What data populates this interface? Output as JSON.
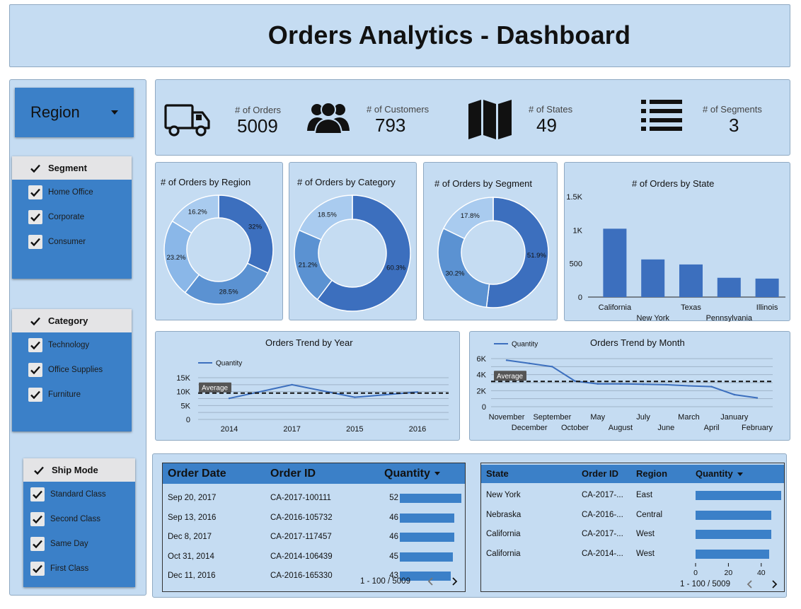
{
  "title": "Orders Analytics - Dashboard",
  "region_dropdown": {
    "label": "Region"
  },
  "filters": {
    "segment": {
      "title": "Segment",
      "items": [
        "Home Office",
        "Corporate",
        "Consumer"
      ]
    },
    "category": {
      "title": "Category",
      "items": [
        "Technology",
        "Office Supplies",
        "Furniture"
      ]
    },
    "ship_mode": {
      "title": "Ship Mode",
      "items": [
        "Standard Class",
        "Second Class",
        "Same Day",
        "First Class"
      ]
    }
  },
  "kpis": {
    "orders": {
      "caption": "# of Orders",
      "value": "5009",
      "icon": "truck-icon"
    },
    "customers": {
      "caption": "# of Customers",
      "value": "793",
      "icon": "users-icon"
    },
    "states": {
      "caption": "# of States",
      "value": "49",
      "icon": "map-icon"
    },
    "segments": {
      "caption": "# of Segments",
      "value": "3",
      "icon": "list-icon"
    }
  },
  "colors": {
    "dark": "#3c6fbe",
    "mid": "#5b92d2",
    "light": "#8ab7e8",
    "lighter": "#a9cbef",
    "panel": "#c5dcf2",
    "accent": "#3b80c8"
  },
  "chart_data": [
    {
      "type": "pie",
      "title": "# of Orders by Region",
      "labels": [
        "32%",
        "28.5%",
        "23.2%",
        "16.2%"
      ],
      "values": [
        32,
        28.5,
        23.2,
        16.2
      ]
    },
    {
      "type": "pie",
      "title": "# of Orders by Category",
      "labels": [
        "60.3%",
        "21.2%",
        "18.5%"
      ],
      "values": [
        60.3,
        21.2,
        18.5
      ]
    },
    {
      "type": "pie",
      "title": "# of Orders by Segment",
      "labels": [
        "51.9%",
        "30.2%",
        "17.8%"
      ],
      "values": [
        51.9,
        30.2,
        17.8
      ]
    },
    {
      "type": "bar",
      "title": "# of Orders by State",
      "categories": [
        "California",
        "New York",
        "Texas",
        "Pennsylvania",
        "Illinois"
      ],
      "values": [
        1021,
        562,
        487,
        288,
        276
      ],
      "ylim": [
        0,
        1500
      ],
      "yticks": [
        "0",
        "500",
        "1K",
        "1.5K"
      ]
    },
    {
      "type": "line",
      "title": "Orders Trend by Year",
      "legend": "Quantity",
      "average_label": "Average",
      "categories": [
        "2014",
        "2017",
        "2015",
        "2016"
      ],
      "values": [
        7581,
        12476,
        7979,
        9837
      ],
      "average": 9468,
      "ylim": [
        0,
        15000
      ],
      "yticks": [
        "0",
        "5K",
        "10K",
        "15K"
      ]
    },
    {
      "type": "line",
      "title": "Orders Trend by Month",
      "legend": "Quantity",
      "average_label": "Average",
      "categories": [
        "November",
        "December",
        "September",
        "October",
        "May",
        "August",
        "July",
        "June",
        "March",
        "April",
        "January",
        "February"
      ],
      "values": [
        5800,
        5400,
        5000,
        3200,
        2850,
        2850,
        2800,
        2750,
        2600,
        2500,
        1500,
        1100
      ],
      "average": 3150,
      "ylim": [
        0,
        6000
      ],
      "yticks": [
        "0",
        "2K",
        "4K",
        "6K"
      ]
    }
  ],
  "table1": {
    "headers": {
      "date": "Order Date",
      "id": "Order ID",
      "qty": "Quantity"
    },
    "rows": [
      {
        "date": "Sep 20, 2017",
        "id": "CA-2017-100111",
        "qty": 52
      },
      {
        "date": "Sep 13, 2016",
        "id": "CA-2016-105732",
        "qty": 46
      },
      {
        "date": "Dec 8, 2017",
        "id": "CA-2017-117457",
        "qty": 46
      },
      {
        "date": "Oct 31, 2014",
        "id": "CA-2014-106439",
        "qty": 45
      },
      {
        "date": "Dec 11, 2016",
        "id": "CA-2016-165330",
        "qty": 43
      }
    ],
    "pager": "1 - 100 / 5009"
  },
  "table2": {
    "headers": {
      "state": "State",
      "id": "Order ID",
      "region": "Region",
      "qty": "Quantity"
    },
    "rows": [
      {
        "state": "New York",
        "id": "CA-2017-...",
        "region": "East",
        "qty": 52
      },
      {
        "state": "Nebraska",
        "id": "CA-2016-...",
        "region": "Central",
        "qty": 46
      },
      {
        "state": "California",
        "id": "CA-2017-...",
        "region": "West",
        "qty": 46
      },
      {
        "state": "California",
        "id": "CA-2014-...",
        "region": "West",
        "qty": 45
      }
    ],
    "axis_ticks": [
      "0",
      "20",
      "40"
    ],
    "pager": "1 - 100 / 5009"
  }
}
